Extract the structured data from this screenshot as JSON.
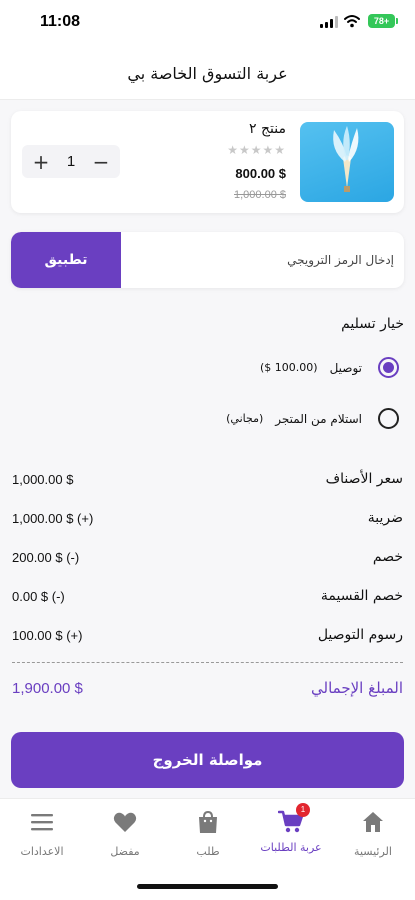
{
  "status_bar": {
    "time": "11:08",
    "battery": "78+"
  },
  "header": {
    "title": "عربة التسوق الخاصة بي"
  },
  "cart_item": {
    "name": "منتج ٢",
    "rating_stars": "★★★★★",
    "price": "800.00 $",
    "old_price": "1,000.00 $",
    "quantity": "1",
    "increment_symbol": "+",
    "decrement_symbol": "−"
  },
  "coupon": {
    "placeholder": "إدخال الرمز الترويجي",
    "apply_label": "تطبيق"
  },
  "delivery": {
    "title": "خيار تسليم",
    "options": [
      {
        "label": "توصيل",
        "extra": "(100.00 $)",
        "selected": true
      },
      {
        "label": "استلام من المتجر",
        "extra": "(مجاني)",
        "selected": false
      }
    ]
  },
  "summary": {
    "rows": [
      {
        "label": "سعر الأصناف",
        "value": "1,000.00 $"
      },
      {
        "label": "ضريبة",
        "value": "1,000.00 $ (+)"
      },
      {
        "label": "خصم",
        "value": "200.00 $ (-)"
      },
      {
        "label": "خصم القسيمة",
        "value": "0.00 $ (-)"
      },
      {
        "label": "رسوم التوصيل",
        "value": "100.00 $ (+)"
      }
    ],
    "total_label": "المبلغ الإجمالي",
    "total_value": "1,900.00 $"
  },
  "checkout": {
    "label": "مواصلة الخروج"
  },
  "bottom_nav": {
    "items": [
      {
        "label": "الرئيسية",
        "icon": "home-icon"
      },
      {
        "label": "عربة الطلبات",
        "icon": "cart-icon",
        "badge": "1"
      },
      {
        "label": "طلب",
        "icon": "shopping-bag-icon"
      },
      {
        "label": "مفضل",
        "icon": "heart-icon"
      },
      {
        "label": "الاعدادات",
        "icon": "menu-icon"
      }
    ]
  },
  "colors": {
    "accent": "#6a3fc1",
    "badge": "#e2262f",
    "battery": "#34c759"
  }
}
